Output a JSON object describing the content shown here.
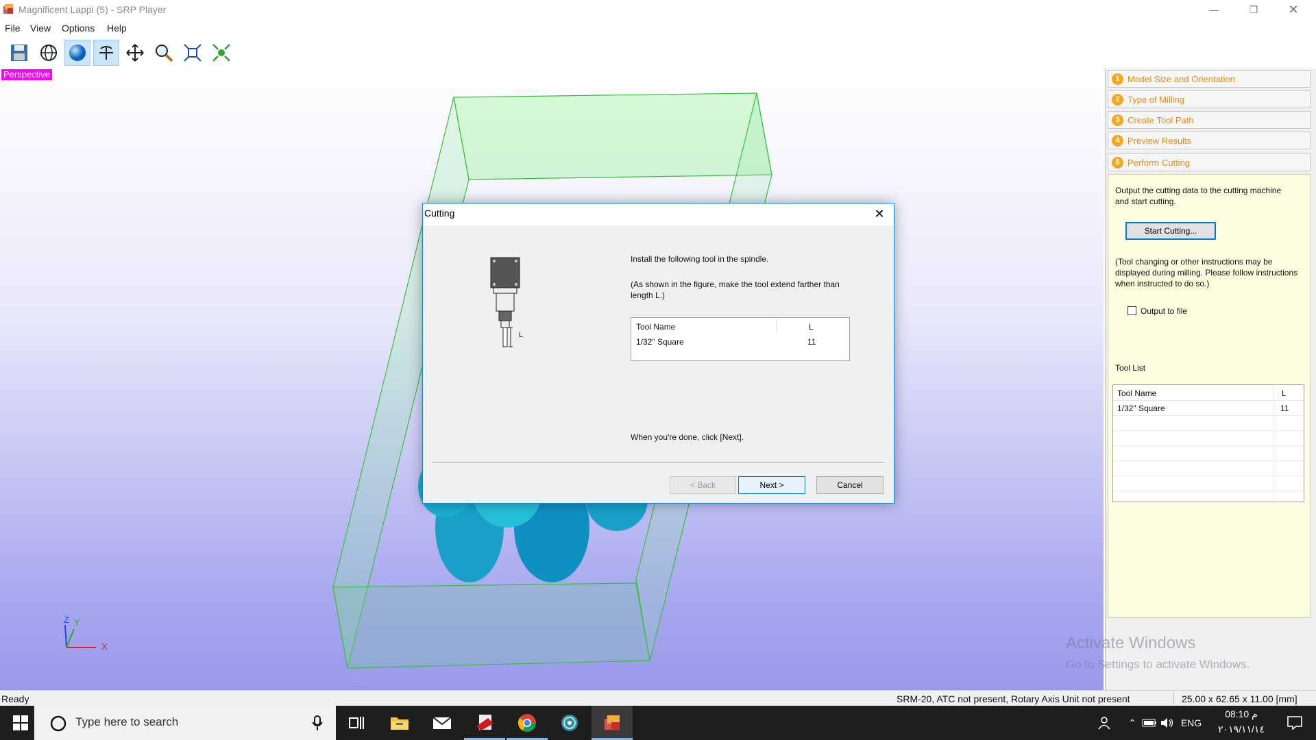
{
  "window": {
    "title": "Magnificent Lappi (5) - SRP Player"
  },
  "menu": [
    "File",
    "View",
    "Options",
    "Help"
  ],
  "toolbar": {
    "icons": [
      "save-icon",
      "globe-icon",
      "sphere-icon",
      "rotate-icon",
      "move-icon",
      "zoom-icon",
      "fit-icon",
      "center-icon"
    ]
  },
  "viewport": {
    "label": "Perspective",
    "axes": {
      "z": "Z",
      "y": "Y",
      "x": "X"
    }
  },
  "steps": [
    {
      "num": "1",
      "label": "Model Size and Orientation"
    },
    {
      "num": "2",
      "label": "Type of Milling"
    },
    {
      "num": "3",
      "label": "Create Tool Path"
    },
    {
      "num": "4",
      "label": "Preview Results"
    },
    {
      "num": "5",
      "label": "Perform Cutting"
    }
  ],
  "panel": {
    "description": "Output the cutting data to the cutting machine and start cutting.",
    "start_button": "Start Cutting...",
    "note": "(Tool changing or other instructions may be displayed during milling. Please follow instructions when instructed to do so.)",
    "output_to_file": "Output to file",
    "tool_list_label": "Tool List",
    "tool_list": {
      "headers": [
        "Tool Name",
        "L"
      ],
      "rows": [
        [
          "1/32\" Square",
          "11"
        ]
      ]
    }
  },
  "dialog": {
    "title": "Cutting",
    "install_text": "Install the following tool in the spindle.",
    "hint_text": "(As shown in the figure, make the tool extend farther than length L.)",
    "figure_label": "L",
    "table": {
      "headers": [
        "Tool Name",
        "L"
      ],
      "rows": [
        [
          "1/32\" Square",
          "11"
        ]
      ]
    },
    "done_text": "When you're done, click [Next].",
    "back_button": "< Back",
    "next_button": "Next >",
    "cancel_button": "Cancel"
  },
  "status": {
    "left": "Ready",
    "machine": "SRM-20, ATC not present, Rotary Axis Unit not present",
    "size": "25.00 x  62.65 x  11.00 [mm]"
  },
  "watermark": {
    "line1": "Activate Windows",
    "line2": "Go to Settings to activate Windows."
  },
  "taskbar": {
    "search_placeholder": "Type here to search",
    "lang": "ENG",
    "time": "08:10 م",
    "date": "٢٠١٩/١١/١٤"
  }
}
